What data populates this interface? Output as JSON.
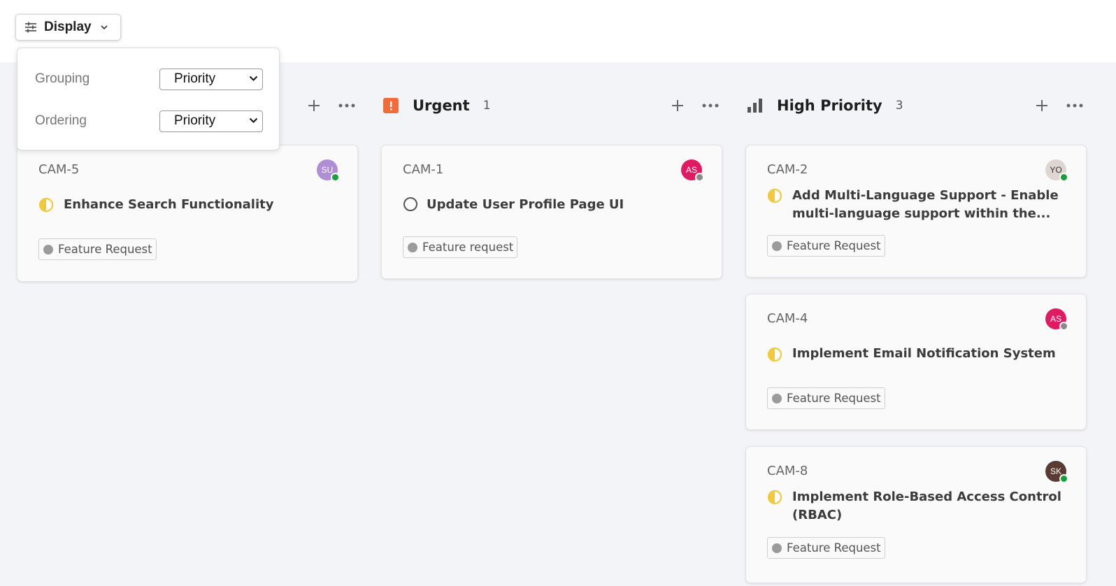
{
  "toolbar": {
    "display_label": "Display"
  },
  "display_menu": {
    "grouping_label": "Grouping",
    "grouping_value": "Priority",
    "ordering_label": "Ordering",
    "ordering_value": "Priority"
  },
  "colors": {
    "urgent": "#f26b3a",
    "medium_status": "#f0c93e",
    "avatar_su": "#b08ed6",
    "avatar_as": "#e01b63",
    "avatar_yo": "#ded6d2",
    "avatar_sk": "#5a3b33",
    "online": "#11a33a",
    "offline": "#8a8a8a"
  },
  "columns": [
    {
      "cards": [
        {
          "id": "CAM-5",
          "title": "Enhance Search Functionality",
          "status_icon": "half-circle-icon",
          "tag": "Feature Request",
          "avatar": "SU",
          "presence": "online"
        }
      ]
    },
    {
      "title": "Urgent",
      "count": "1",
      "icon": "urgent-icon",
      "cards": [
        {
          "id": "CAM-1",
          "title": "Update User Profile Page UI",
          "status_icon": "empty-circle-icon",
          "tag": "Feature request",
          "avatar": "AS",
          "presence": "offline"
        }
      ]
    },
    {
      "title": "High Priority",
      "count": "3",
      "icon": "signal-bars-icon",
      "cards": [
        {
          "id": "CAM-2",
          "title": "Add Multi-Language Support - Enable multi-language support within the...",
          "status_icon": "half-circle-icon",
          "tag": "Feature Request",
          "avatar": "YO",
          "presence": "online"
        },
        {
          "id": "CAM-4",
          "title": "Implement Email Notification System",
          "status_icon": "half-circle-icon",
          "tag": "Feature Request",
          "avatar": "AS",
          "presence": "offline"
        },
        {
          "id": "CAM-8",
          "title": "Implement Role-Based Access Control (RBAC)",
          "status_icon": "half-circle-icon",
          "tag": "Feature Request",
          "avatar": "SK",
          "presence": "online"
        }
      ]
    }
  ]
}
